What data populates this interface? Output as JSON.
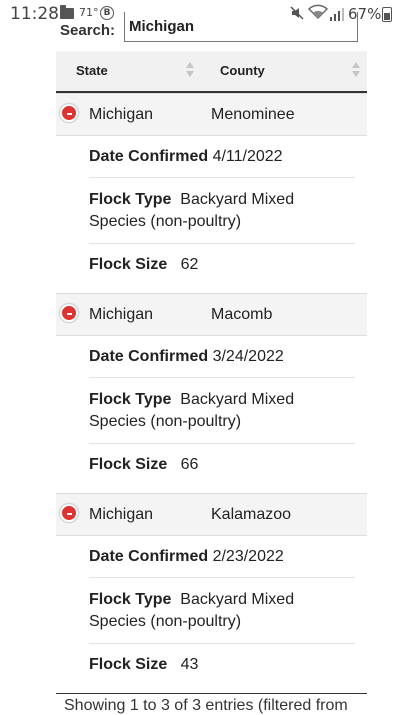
{
  "status_bar": {
    "time": "11:28",
    "temp": "71°",
    "b_badge": "B",
    "battery_text": "67%"
  },
  "search": {
    "label": "Search:",
    "value": "Michigan"
  },
  "table": {
    "headers": [
      "State",
      "County"
    ],
    "rows": [
      {
        "state": "Michigan",
        "county": "Menominee",
        "date_label": "Date Confirmed",
        "date_value": "4/11/2022",
        "type_label": "Flock Type",
        "type_value": "Backyard Mixed Species (non-poultry)",
        "size_label": "Flock Size",
        "size_value": "62"
      },
      {
        "state": "Michigan",
        "county": "Macomb",
        "date_label": "Date Confirmed",
        "date_value": "3/24/2022",
        "type_label": "Flock Type",
        "type_value": "Backyard Mixed Species (non-poultry)",
        "size_label": "Flock Size",
        "size_value": "66"
      },
      {
        "state": "Michigan",
        "county": "Kalamazoo",
        "date_label": "Date Confirmed",
        "date_value": "2/23/2022",
        "type_label": "Flock Type",
        "type_value": "Backyard Mixed Species (non-poultry)",
        "size_label": "Flock Size",
        "size_value": "43"
      }
    ]
  },
  "footer": {
    "info": "Showing 1 to 3 of 3 entries (filtered from"
  }
}
